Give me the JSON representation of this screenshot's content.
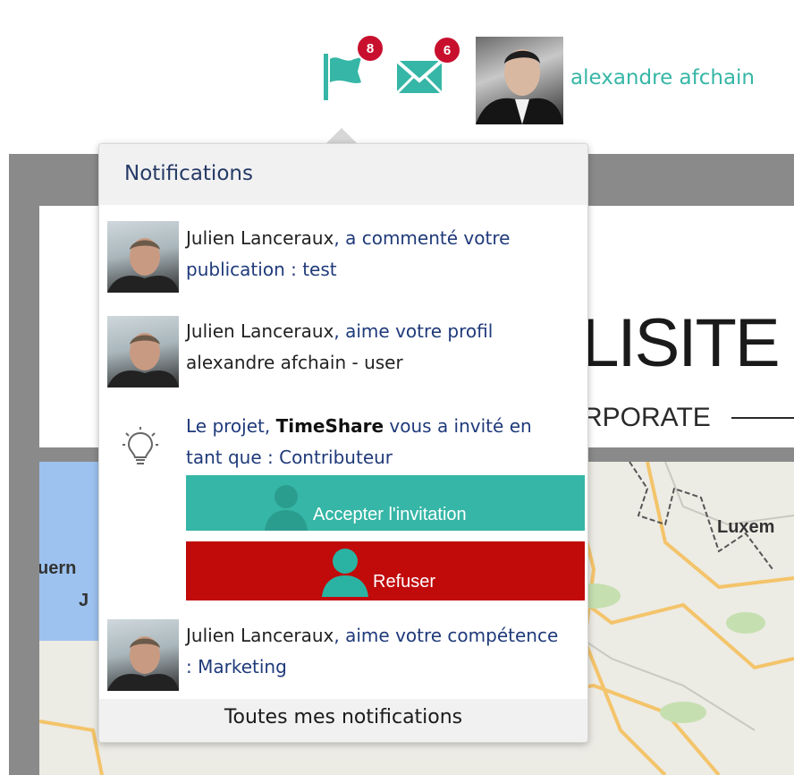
{
  "background": {
    "brand_text": "LLISITE",
    "brand_sub": "RPORATE",
    "map_labels": [
      "Luxem",
      "uern",
      "J"
    ]
  },
  "topbar": {
    "notifications_badge": "8",
    "messages_badge": "6",
    "username": "alexandre afchain"
  },
  "dropdown": {
    "title": "Notifications",
    "items": [
      {
        "name": "Julien Lanceraux",
        "text": ", a commenté votre publication : test"
      },
      {
        "name": "Julien Lanceraux",
        "text": ", aime votre profil",
        "text2": "alexandre afchain - user"
      },
      {
        "prefix": "Le projet, ",
        "project": "TimeShare",
        "text": " vous a invité en tant que : Contributeur"
      },
      {
        "name": "Julien Lanceraux",
        "text": ", aime votre compétence : Marketing"
      }
    ],
    "accept_label": "Accepter l'invitation",
    "refuse_label": "Refuser",
    "footer_label": "Toutes mes notifications"
  },
  "colors": {
    "accent": "#36b6a6",
    "danger": "#c10a0a",
    "badge": "#c8102e",
    "link": "#1f3a7a"
  },
  "icons": [
    "flag-icon",
    "envelope-icon",
    "lightbulb-icon",
    "user-icon"
  ]
}
